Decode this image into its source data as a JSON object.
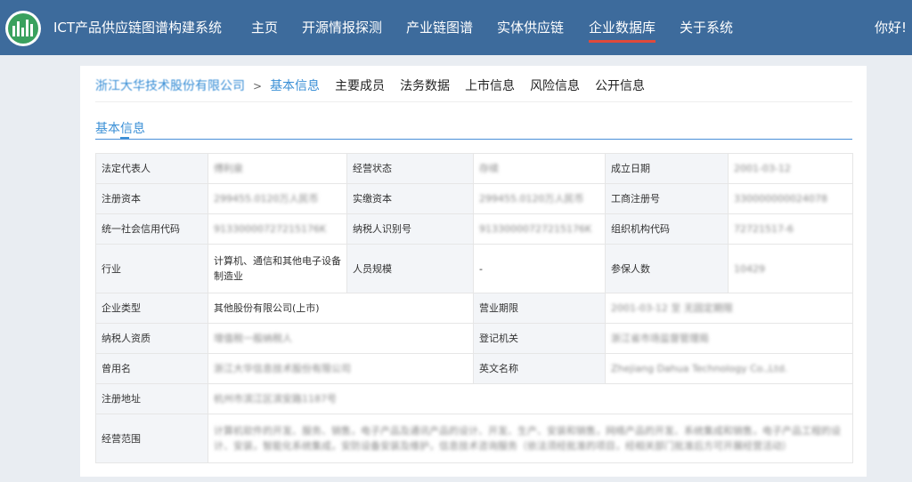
{
  "header": {
    "app_title": "ICT产品供应链图谱构建系统",
    "nav": [
      "主页",
      "开源情报探测",
      "产业链图谱",
      "实体供应链",
      "企业数据库",
      "关于系统"
    ],
    "active_nav": "企业数据库",
    "greeting": "你好!",
    "accent_color": "#e0493b",
    "bar_color": "#3d6b9c"
  },
  "breadcrumb": {
    "company": "浙江大华技术股份有限公司",
    "separator": ">",
    "current": "基本信息"
  },
  "subnav": [
    "主要成员",
    "法务数据",
    "上市信息",
    "风险信息",
    "公开信息"
  ],
  "section_title": "基本信息",
  "rows_six": [
    {
      "l1": "法定代表人",
      "v1": "傅利泉",
      "l2": "经营状态",
      "v2": "存续",
      "l3": "成立日期",
      "v3": "2001-03-12"
    },
    {
      "l1": "注册资本",
      "v1": "299455.0120万人民币",
      "l2": "实缴资本",
      "v2": "299455.0120万人民币",
      "l3": "工商注册号",
      "v3": "330000000024078"
    },
    {
      "l1": "统一社会信用代码",
      "v1": "91330000727215176K",
      "l2": "纳税人识别号",
      "v2": "91330000727215176K",
      "l3": "组织机构代码",
      "v3": "72721517-6"
    },
    {
      "l1": "行业",
      "v1": "计算机、通信和其他电子设备制造业",
      "l2": "人员规模",
      "v2": "-",
      "l3": "参保人数",
      "v3": "10429"
    }
  ],
  "rows_four": [
    {
      "l1": "企业类型",
      "v1": "其他股份有限公司(上市)",
      "l2": "营业期限",
      "v2": "2001-03-12 至 无固定期限"
    },
    {
      "l1": "纳税人资质",
      "v1": "增值税一般纳税人",
      "l2": "登记机关",
      "v2": "浙江省市场监督管理局"
    },
    {
      "l1": "曾用名",
      "v1": "浙江大华信息技术股份有限公司",
      "l2": "英文名称",
      "v2": "Zhejiang Dahua Technology Co.,Ltd."
    }
  ],
  "rows_two": [
    {
      "l1": "注册地址",
      "v1": "杭州市滨江区滨安路1187号"
    },
    {
      "l1": "经营范围",
      "v1": "计算机软件的开发、服务、销售，电子产品及通讯产品的设计、开发、生产、安装和销售，网络产品的开发、系统集成和销售，电子产品工程的设计、安装，智能化系统集成，安防设备安装及维护，信息技术咨询服务（依法须经批准的项目，经相关部门批准后方可开展经营活动）"
    }
  ]
}
